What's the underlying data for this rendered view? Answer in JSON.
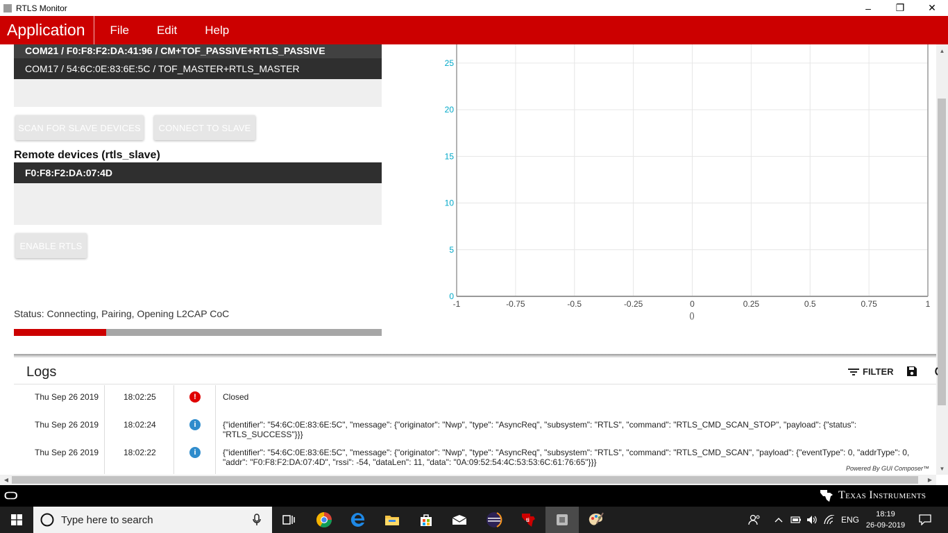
{
  "window": {
    "title": "RTLS Monitor",
    "minimize": "–",
    "restore": "❐",
    "close": "✕"
  },
  "menubar": {
    "brand": "Application",
    "items": [
      "File",
      "Edit",
      "Help"
    ]
  },
  "devices": {
    "local": [
      "COM21 / F0:F8:F2:DA:41:96 / CM+TOF_PASSIVE+RTLS_PASSIVE",
      "COM17 / 54:6C:0E:83:6E:5C / TOF_MASTER+RTLS_MASTER"
    ],
    "scan_button": "SCAN FOR SLAVE DEVICES",
    "connect_button": "CONNECT TO SLAVE",
    "remote_title": "Remote devices (rtls_slave)",
    "remote": [
      "F0:F8:F2:DA:07:4D"
    ],
    "enable_button": "ENABLE RTLS"
  },
  "status": {
    "text": "Status: Connecting, Pairing, Opening L2CAP CoC",
    "progress": 0.25
  },
  "chart_data": {
    "type": "scatter",
    "title": "",
    "xlabel": "()",
    "ylabel": "",
    "xlim": [
      -1,
      1
    ],
    "ylim": [
      0,
      27
    ],
    "xticks": [
      "-1",
      "-0.75",
      "-0.5",
      "-0.25",
      "0",
      "0.25",
      "0.5",
      "0.75",
      "1"
    ],
    "yticks": [
      "0",
      "5",
      "10",
      "15",
      "20",
      "25"
    ],
    "grid": true,
    "series": [],
    "colors": {
      "tick_y": "#00a8c8",
      "grid": "#e6e6e6",
      "axis": "#999999"
    }
  },
  "logs": {
    "title": "Logs",
    "filter_label": "FILTER",
    "rows": [
      {
        "date": "Thu Sep 26 2019",
        "time": "18:02:25",
        "level": "error",
        "glyph": "!",
        "message": "Closed"
      },
      {
        "date": "Thu Sep 26 2019",
        "time": "18:02:24",
        "level": "info",
        "glyph": "i",
        "message": "{\"identifier\": \"54:6C:0E:83:6E:5C\", \"message\": {\"originator\": \"Nwp\", \"type\": \"AsyncReq\", \"subsystem\": \"RTLS\", \"command\": \"RTLS_CMD_SCAN_STOP\", \"payload\": {\"status\": \"RTLS_SUCCESS\"}}}"
      },
      {
        "date": "Thu Sep 26 2019",
        "time": "18:02:22",
        "level": "info",
        "glyph": "i",
        "message": "{\"identifier\": \"54:6C:0E:83:6E:5C\", \"message\": {\"originator\": \"Nwp\", \"type\": \"AsyncReq\", \"subsystem\": \"RTLS\", \"command\": \"RTLS_CMD_SCAN\", \"payload\": {\"eventType\": 0, \"addrType\": 0, \"addr\": \"F0:F8:F2:DA:07:4D\", \"rssi\": -54, \"dataLen\": 11, \"data\": \"0A:09:52:54:4C:53:53:6C:61:76:65\"}}}"
      }
    ],
    "powered_by": "Powered By GUI Composer™"
  },
  "footer": {
    "left_logo": "ᑕᑐ",
    "brand": "Texas Instruments"
  },
  "taskbar": {
    "search_placeholder": "Type here to search",
    "language": "ENG",
    "time": "18:19",
    "date": "26-09-2019"
  },
  "colors": {
    "brand_red": "#cc0000",
    "dark_row": "#2f2f2f"
  }
}
